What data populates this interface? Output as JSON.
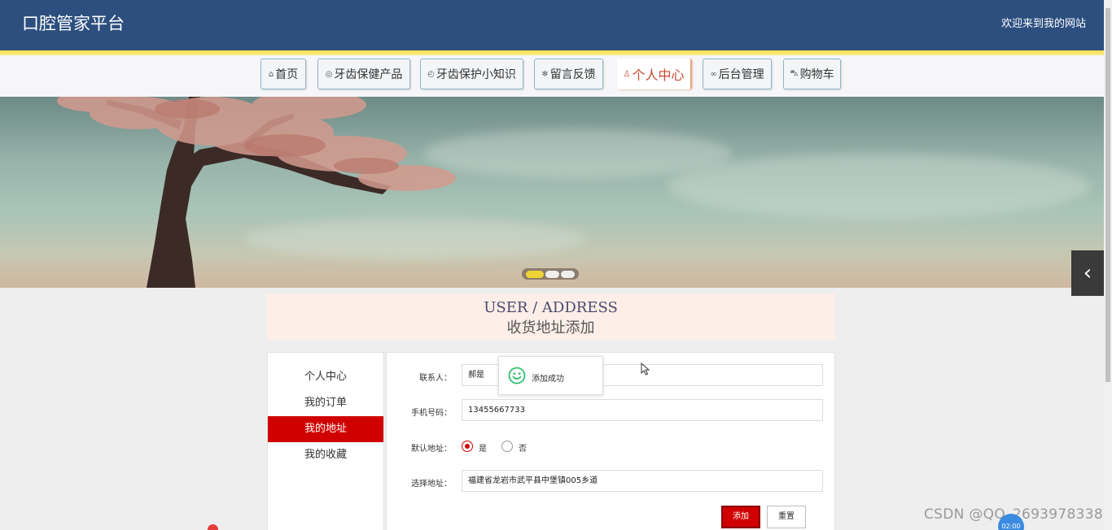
{
  "header": {
    "title": "口腔管家平台",
    "welcome": "欢迎来到我的网站"
  },
  "nav": [
    {
      "label": "首页",
      "icon": "home-icon",
      "glyph": "⌂"
    },
    {
      "label": "牙齿保健产品",
      "icon": "target-icon",
      "glyph": "◎"
    },
    {
      "label": "牙齿保护小知识",
      "icon": "power-icon",
      "glyph": "◴"
    },
    {
      "label": "留言反馈",
      "icon": "snowflake-icon",
      "glyph": "❄"
    },
    {
      "label": "个人中心",
      "icon": "user-icon",
      "glyph": "♙",
      "active": true
    },
    {
      "label": "后台管理",
      "icon": "link-icon",
      "glyph": "∞"
    },
    {
      "label": "购物车",
      "icon": "cart-icon",
      "glyph": "⛍"
    }
  ],
  "banner": {
    "active_slide": 1,
    "slide_count": 3
  },
  "page_head": {
    "en": "USER / ADDRESS",
    "cn": "收货地址添加"
  },
  "sidebar": {
    "items": [
      {
        "label": "个人中心"
      },
      {
        "label": "我的订单"
      },
      {
        "label": "我的地址",
        "active": true
      },
      {
        "label": "我的收藏"
      }
    ]
  },
  "form": {
    "contact_label": "联系人：",
    "contact_value": "郝是",
    "phone_label": "手机号码：",
    "phone_value": "13455667733",
    "default_label": "默认地址：",
    "default_yes": "是",
    "default_no": "否",
    "default_selected": "是",
    "address_label": "选择地址：",
    "address_value": "福建省龙岩市武平县中堡镇005乡道",
    "add_button": "添加",
    "reset_button": "重置"
  },
  "toast": {
    "message": "添加成功"
  },
  "watermark": "CSDN @QQ_2693978338",
  "clock_badge": "02:00",
  "colors": {
    "header": "#2d4f7f",
    "accent_red": "#d00000",
    "nav_active": "#c7482d"
  }
}
